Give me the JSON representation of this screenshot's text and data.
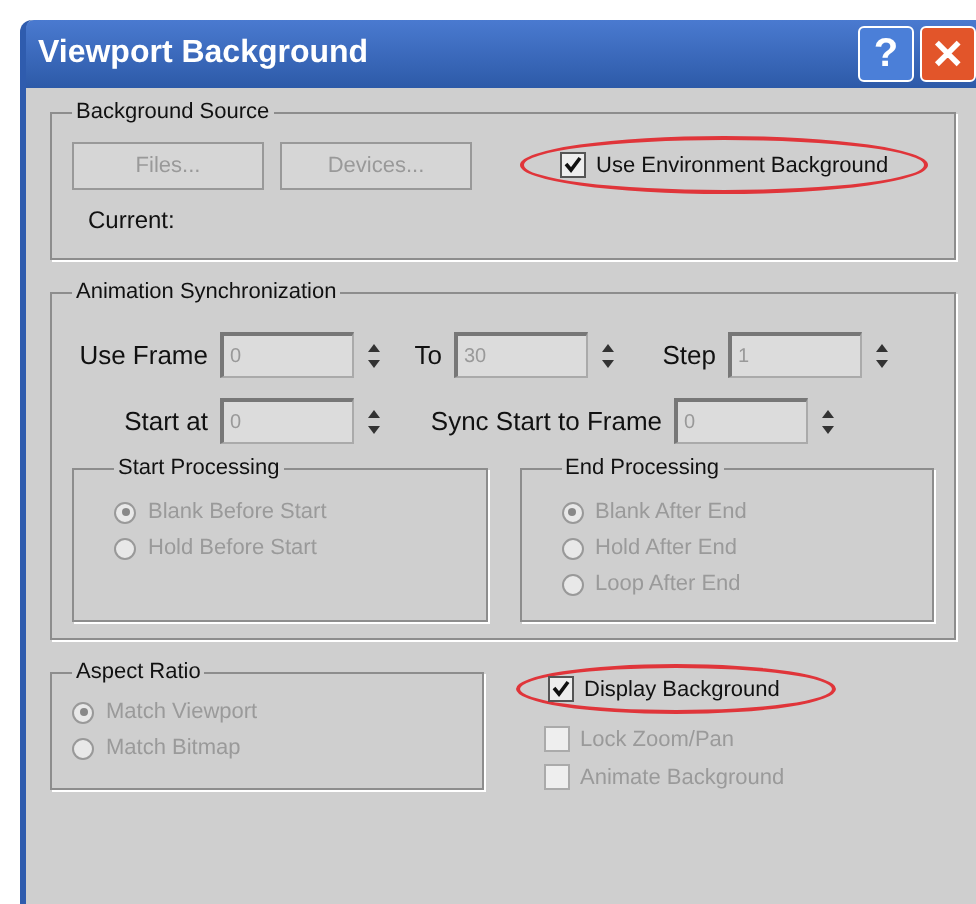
{
  "window": {
    "title": "Viewport Background",
    "buttons": [
      "?",
      "✕"
    ]
  },
  "background_source": {
    "title": "Background Source",
    "buttons": [
      {
        "label": "Files...",
        "disabled": true
      },
      {
        "label": "Devices...",
        "disabled": true
      }
    ],
    "checkbox": {
      "label": "Use Environment Background",
      "checked": true,
      "disabled": false,
      "highlighted": true
    },
    "current_label": "Current:"
  },
  "animation_sync": {
    "title": "Animation Synchronization",
    "row_1": [
      {
        "label": "Use Frame",
        "value": "0",
        "disabled": true
      },
      {
        "label": "To",
        "value": "30",
        "disabled": true
      },
      {
        "label": "Step",
        "value": "1",
        "disabled": true
      }
    ],
    "row_2": [
      {
        "label": "Start at",
        "value": "0",
        "disabled": true
      },
      {
        "label": "Sync Start to Frame",
        "value": "0",
        "disabled": true
      }
    ],
    "groups": [
      {
        "title": "Start Processing",
        "options": [
          {
            "label": "Blank Before Start",
            "selected": true,
            "disabled": true
          },
          {
            "label": "Hold Before Start",
            "selected": false,
            "disabled": true
          }
        ]
      },
      {
        "title": "End Processing",
        "options": [
          {
            "label": "Blank After End",
            "selected": true,
            "disabled": true
          },
          {
            "label": "Hold After End",
            "selected": false,
            "disabled": true
          },
          {
            "label": "Loop After End",
            "selected": false,
            "disabled": true
          }
        ]
      }
    ]
  },
  "aspect_ratio": {
    "title": "Aspect Ratio",
    "options": [
      {
        "label": "Match Viewport",
        "selected": true,
        "disabled": true
      },
      {
        "label": "Match Bitmap",
        "selected": false,
        "disabled": true
      }
    ]
  },
  "display_options": [
    {
      "label": "Display Background",
      "checked": true,
      "disabled": false,
      "highlighted": true
    },
    {
      "label": "Lock Zoom/Pan",
      "checked": false,
      "disabled": true,
      "highlighted": false
    },
    {
      "label": "Animate Background",
      "checked": false,
      "disabled": true,
      "highlighted": false
    }
  ]
}
